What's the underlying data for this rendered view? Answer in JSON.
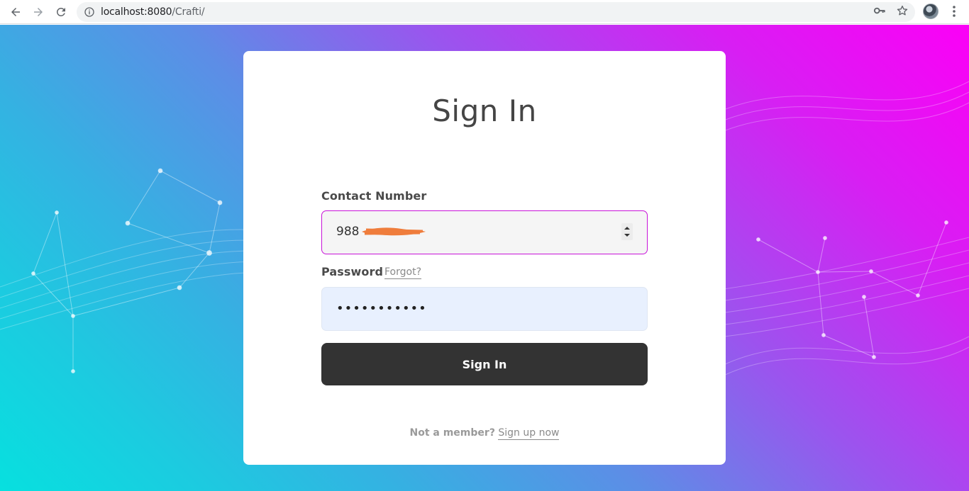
{
  "browser": {
    "url_host": "localhost:8080",
    "url_path": "/Crafti/",
    "icons": [
      "back-icon",
      "forward-icon",
      "reload-icon",
      "info-icon",
      "key-icon",
      "star-icon",
      "avatar",
      "menu-icon"
    ]
  },
  "signin": {
    "title": "Sign In",
    "contact_label": "Contact Number",
    "contact_value": "988",
    "password_label": "Password",
    "forgot_label": "Forgot?",
    "password_value": "•••••••••••",
    "button_label": "Sign In",
    "footer_question": "Not a member?",
    "footer_link": "Sign up now"
  },
  "colors": {
    "accent_border": "#c813d9",
    "button_bg": "#333333",
    "gradient_start": "#07e0df",
    "gradient_end": "#fb00f6",
    "redaction": "#ef7d3c"
  }
}
